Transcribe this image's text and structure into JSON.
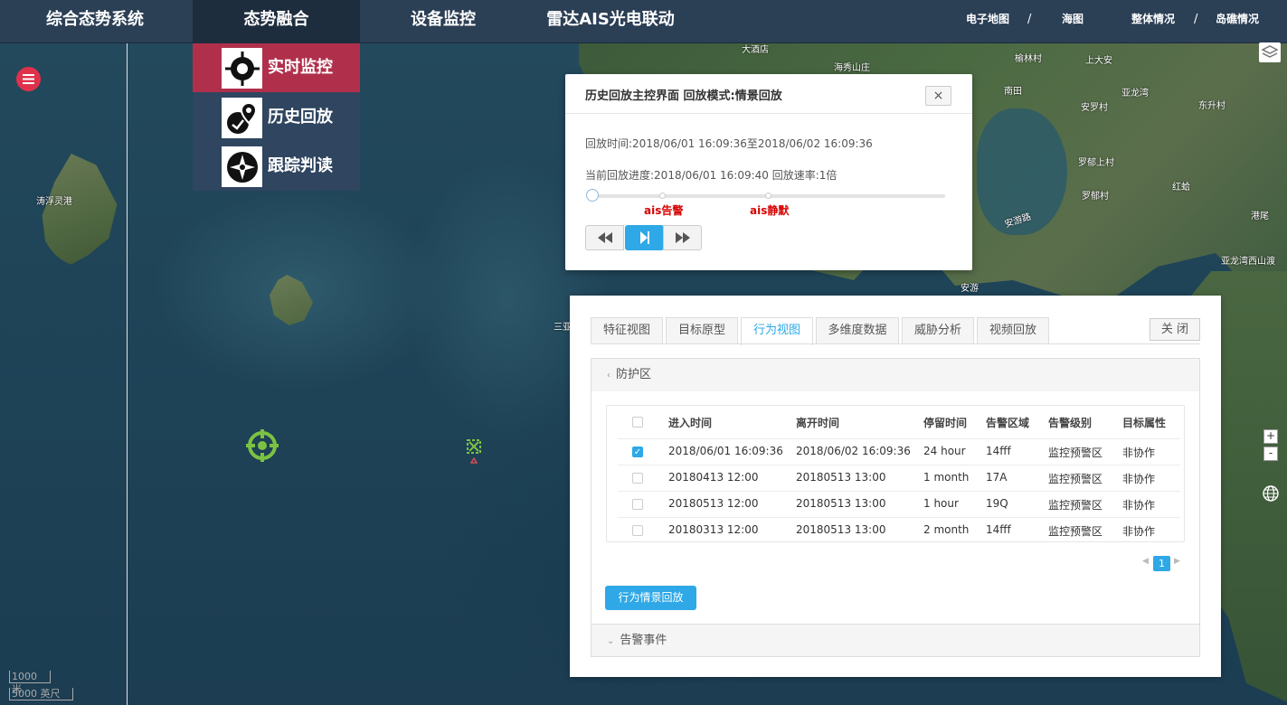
{
  "nav": {
    "items": [
      "综合态势系统",
      "态势融合",
      "设备监控",
      "雷达AIS光电联动"
    ],
    "right": [
      "电子地图",
      "海图",
      "整体情况",
      "岛礁情况"
    ],
    "separator": "/"
  },
  "dropdown": {
    "items": [
      {
        "label": "实时监控",
        "icon": "crosshair-icon"
      },
      {
        "label": "历史回放",
        "icon": "location-history-icon"
      },
      {
        "label": "跟踪判读",
        "icon": "compass-icon"
      }
    ]
  },
  "map": {
    "labels": [
      "大酒店",
      "海秀山庄",
      "榆林村",
      "上大安",
      "南田",
      "亚龙湾",
      "安罗村",
      "东升村",
      "罗郁上村",
      "罗郁村",
      "红蛤",
      "港尾",
      "亚龙湾西山渡",
      "安游路",
      "安游",
      "涛浮灵港",
      "三亚"
    ],
    "scale": [
      "1000 米",
      "5000 英尺"
    ]
  },
  "playback": {
    "title": "历史回放主控界面 回放模式:情景回放",
    "close": "×",
    "time_range": "回放时间:2018/06/01 16:09:36至2018/06/02 16:09:36",
    "progress": "当前回放进度:2018/06/01 16:09:40 回放速率:1倍",
    "marks": [
      "ais告警",
      "ais静默"
    ]
  },
  "panel": {
    "tabs": [
      "特征视图",
      "目标原型",
      "行为视图",
      "多维度数据",
      "威胁分析",
      "视频回放"
    ],
    "active_tab": "行为视图",
    "close": "关 闭",
    "section1": "防护区",
    "section2": "告警事件",
    "columns": [
      "进入时间",
      "离开时间",
      "停留时间",
      "告警区域",
      "告警级别",
      "目标属性"
    ],
    "rows": [
      {
        "checked": true,
        "cells": [
          "2018/06/01 16:09:36",
          "2018/06/02 16:09:36",
          "24 hour",
          "14fff",
          "监控预警区",
          "非协作"
        ]
      },
      {
        "checked": false,
        "cells": [
          "20180413 12:00",
          "20180513 13:00",
          "1 month",
          "17A",
          "监控预警区",
          "非协作"
        ]
      },
      {
        "checked": false,
        "cells": [
          "20180513 12:00",
          "20180513 13:00",
          "1 hour",
          "19Q",
          "监控预警区",
          "非协作"
        ]
      },
      {
        "checked": false,
        "cells": [
          "20180313 12:00",
          "20180513 13:00",
          "2 month",
          "14fff",
          "监控预警区",
          "非协作"
        ]
      }
    ],
    "page": "1",
    "replay_button": "行为情景回放"
  },
  "controls": {
    "zoom_in": "+",
    "zoom_out": "-"
  },
  "colors": {
    "accent": "#2ea8e6",
    "nav_bg": "#2b3f55",
    "active_menu": "#b0304b",
    "alert": "#d60000",
    "target": "#7cc242"
  }
}
